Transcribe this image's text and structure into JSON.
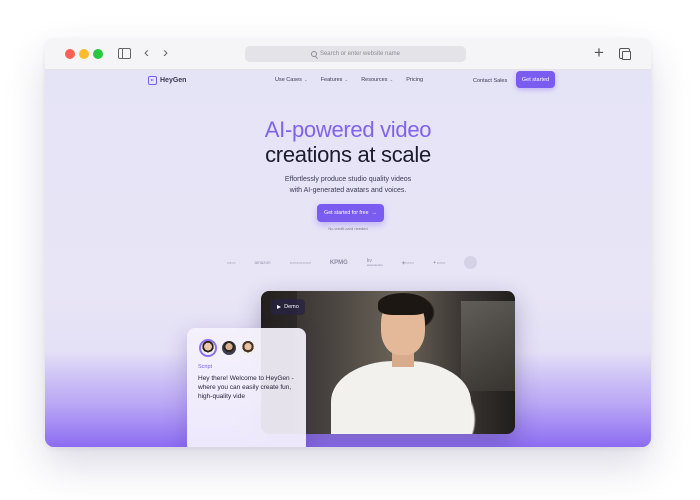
{
  "browser": {
    "address_placeholder": "Search or enter website name",
    "back_glyph": "‹",
    "forward_glyph": "›",
    "new_tab_glyph": "+"
  },
  "site": {
    "brand": "HeyGen",
    "nav": [
      {
        "label": "Use Cases",
        "has_dropdown": true
      },
      {
        "label": "Features",
        "has_dropdown": true
      },
      {
        "label": "Resources",
        "has_dropdown": true
      },
      {
        "label": "Pricing",
        "has_dropdown": false
      }
    ],
    "contact_label": "Contact Sales",
    "get_started_label": "Get started"
  },
  "hero": {
    "title_line1": "AI-powered video",
    "title_line2": "creations at scale",
    "subtitle_line1": "Effortlessly produce studio quality videos",
    "subtitle_line2": "with AI-generated avatars and voices.",
    "cta_label": "Get started for free",
    "cta_arrow": "→",
    "note": "No credit card needed"
  },
  "logos": {
    "items": [
      "amazon",
      "KPMG",
      "kv"
    ],
    "kv_sub": "accessories"
  },
  "demo": {
    "badge_label": "Demo"
  },
  "script_card": {
    "label": "Script",
    "text": "Hey there! Welcome to HeyGen - where you can easily create fun, high-quality vide"
  },
  "colors": {
    "accent": "#7b5cf0",
    "page_bg": "#e5e3f6",
    "title_accent": "#7f64ea"
  }
}
